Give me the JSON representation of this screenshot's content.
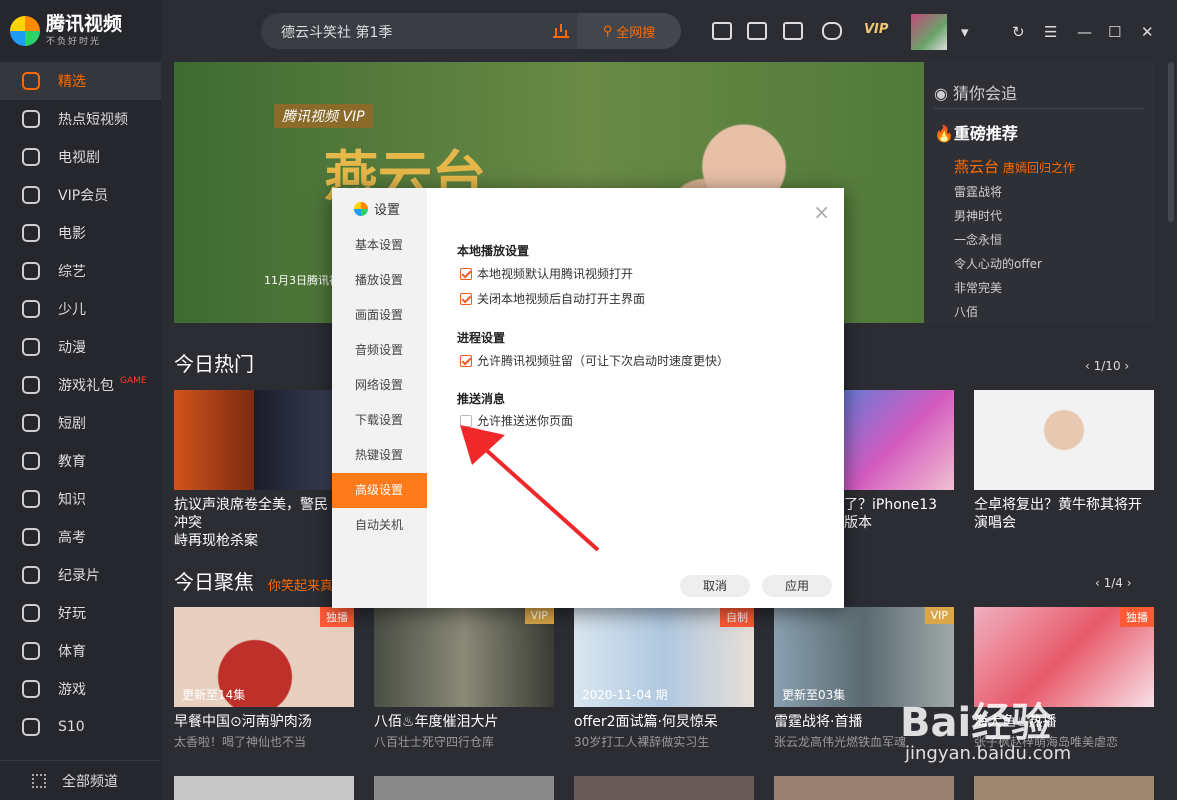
{
  "app": {
    "name": "腾讯视频",
    "slogan": "不负好时光"
  },
  "search": {
    "value": "德云斗笑社 第1季",
    "button": "全网搜"
  },
  "topbar": {
    "vip": "VIP"
  },
  "sidebar": {
    "items": [
      {
        "label": "精选"
      },
      {
        "label": "热点短视频"
      },
      {
        "label": "电视剧"
      },
      {
        "label": "VIP会员"
      },
      {
        "label": "电影"
      },
      {
        "label": "综艺"
      },
      {
        "label": "少儿"
      },
      {
        "label": "动漫"
      },
      {
        "label": "游戏礼包",
        "badge": "GAME"
      },
      {
        "label": "短剧"
      },
      {
        "label": "教育"
      },
      {
        "label": "知识"
      },
      {
        "label": "高考"
      },
      {
        "label": "纪录片"
      },
      {
        "label": "好玩"
      },
      {
        "label": "体育"
      },
      {
        "label": "游戏"
      },
      {
        "label": "S10"
      }
    ],
    "bottom": "全部频道"
  },
  "banner": {
    "logo": "腾讯视频 VIP",
    "title": "燕云台",
    "date": "11月3日腾讯视"
  },
  "recommend": {
    "heading": "猜你会追",
    "hot": "重磅推荐",
    "first": "燕云台",
    "first_sub": "唐嫣回归之作",
    "items": [
      "雷霆战将",
      "男神时代",
      "一念永恒",
      "令人心动的offer",
      "非常完美",
      "八佰"
    ]
  },
  "hot_today": {
    "title": "今日热门",
    "pager": "1/10",
    "cards": [
      {
        "title": "抗议声浪席卷全美，警民冲突",
        "title2": "峙再现枪杀案"
      },
      {
        "title": "了？iPhone13",
        "title2": "版本"
      },
      {
        "title": "仝卓将复出？黄牛称其将开",
        "title2": "演唱会"
      }
    ]
  },
  "focus": {
    "title": "今日聚焦",
    "subtitle": "你笑起来真",
    "pager": "1/4",
    "cards": [
      {
        "badge": "独播",
        "ep": "更新至14集",
        "title": "早餐中国⊙河南驴肉汤",
        "sub": "太香啦！喝了神仙也不当"
      },
      {
        "badge": "VIP",
        "ep": "",
        "title": "八佰♨年度催泪大片",
        "sub": "八百壮士死守四行仓库"
      },
      {
        "badge": "自制",
        "ep": "2020-11-04 期",
        "title": "offer2面试篇·何炅惊呆",
        "sub": "30岁打工人裸辞做实习生"
      },
      {
        "badge": "VIP",
        "ep": "更新至03集",
        "title": "雷霆战将·首播",
        "sub": "张云龙高伟光燃铁血军魂"
      },
      {
        "badge": "独播",
        "ep": "",
        "title": "海大鱼♨热播",
        "sub": "张子枫赵梓萌海岛唯美虐恋"
      }
    ]
  },
  "dialog": {
    "title": "设置",
    "close": "×",
    "nav": [
      "基本设置",
      "播放设置",
      "画面设置",
      "音频设置",
      "网络设置",
      "下载设置",
      "热键设置",
      "高级设置",
      "自动关机"
    ],
    "groups": [
      {
        "title": "本地播放设置",
        "options": [
          {
            "label": "本地视频默认用腾讯视频打开",
            "checked": true
          },
          {
            "label": "关闭本地视频后自动打开主界面",
            "checked": true
          }
        ]
      },
      {
        "title": "进程设置",
        "options": [
          {
            "label": "允许腾讯视频驻留（可让下次启动时速度更快）",
            "checked": true
          }
        ]
      },
      {
        "title": "推送消息",
        "options": [
          {
            "label": "允许推送迷你页面",
            "checked": false
          }
        ]
      }
    ],
    "cancel": "取消",
    "apply": "应用"
  },
  "watermark": {
    "main": "Bai经验",
    "url": "jingyan.baidu.com"
  }
}
